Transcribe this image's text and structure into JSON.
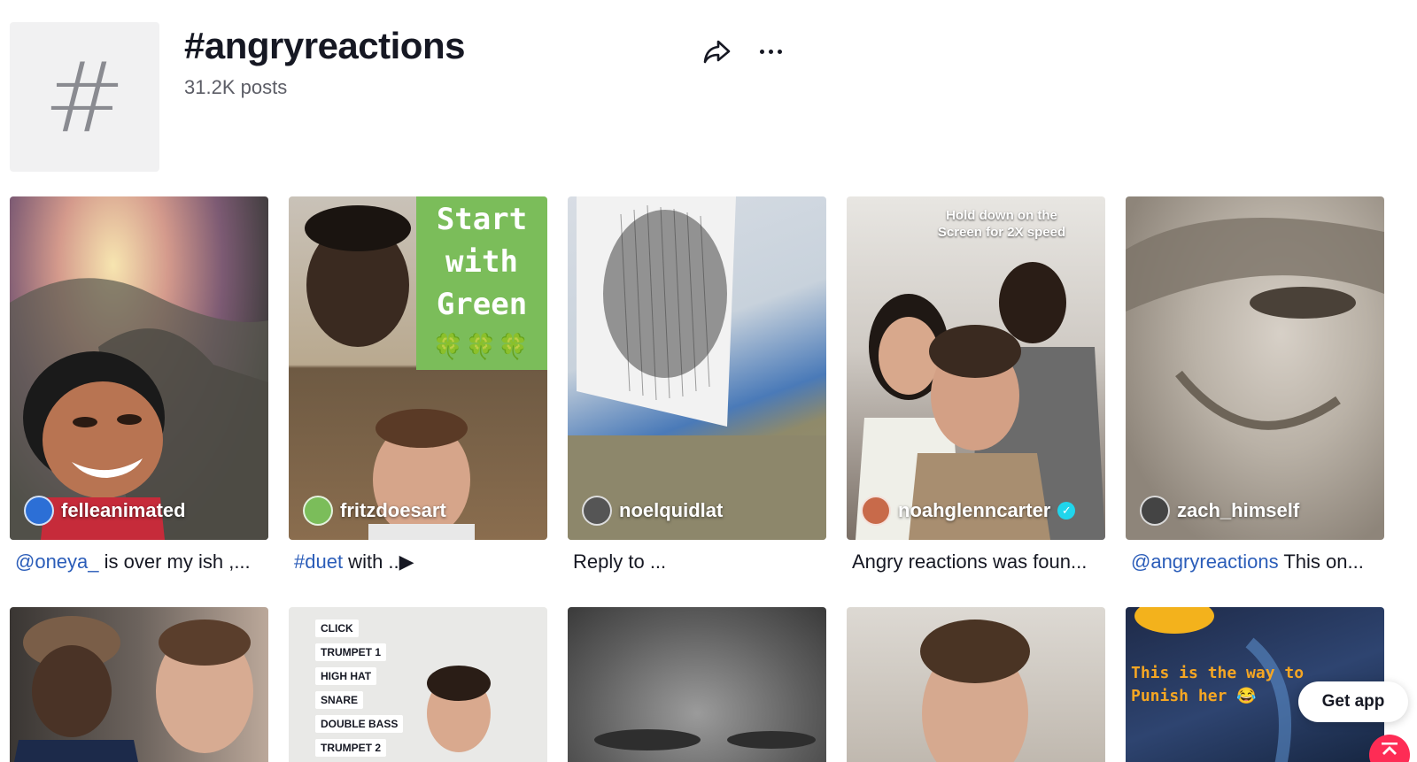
{
  "header": {
    "hash_symbol": "#",
    "title": "#angryreactions",
    "posts": "31.2K posts",
    "share_icon": "share-icon",
    "more_icon": "more-icon"
  },
  "videos": [
    {
      "username": "felleanimated",
      "caption_tag": "@oneya_",
      "caption_text": " is over my ish ,...",
      "avatar_color": "#2c6fd6"
    },
    {
      "username": "fritzdoesart",
      "caption_tag": "#duet",
      "caption_text": " with ..▶",
      "avatar_color": "#7bbd5a",
      "overlay_lines": [
        "Start",
        "with",
        "Green"
      ],
      "overlay_emoji": "🍀🍀🍀"
    },
    {
      "username": "noelquidlat",
      "caption_tag": "",
      "caption_text": "Reply to ...",
      "avatar_color": "#555555"
    },
    {
      "username": "noahglenncarter",
      "caption_tag": "",
      "caption_text": "Angry reactions was foun...",
      "avatar_color": "#c86a4a",
      "verified": true,
      "overlay_lines": [
        "Hold down on the",
        "Screen for 2X speed"
      ]
    },
    {
      "username": "zach_himself",
      "caption_tag": "@angryreactions",
      "caption_text": " This on...",
      "avatar_color": "#444444"
    }
  ],
  "row2": {
    "music_labels": [
      "CLICK",
      "TRUMPET 1",
      "HIGH HAT",
      "SNARE",
      "DOUBLE BASS",
      "TRUMPET 2"
    ],
    "punish_line1": "This is the  way to",
    "punish_line2": "Punish her 😂"
  },
  "get_app": "Get app",
  "colors": {
    "accent": "#fe2c55",
    "link": "#2b5db9",
    "verified": "#20d5ec"
  }
}
